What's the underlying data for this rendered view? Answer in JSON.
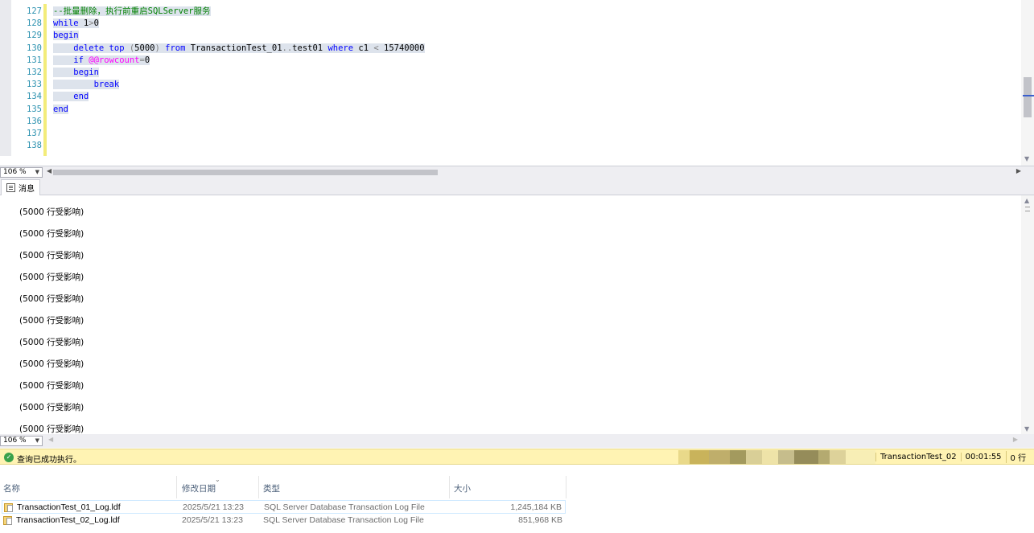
{
  "editor": {
    "line_numbers": [
      "127",
      "128",
      "129",
      "130",
      "131",
      "132",
      "133",
      "134",
      "135",
      "136",
      "137",
      "138"
    ],
    "lines": [
      [
        {
          "t": "--批量删除，执行前重启SQLServer服务",
          "c": "cm"
        }
      ],
      [
        {
          "t": "while",
          "c": "kw"
        },
        {
          "t": " 1",
          "c": "tx"
        },
        {
          "t": ">",
          "c": "gr"
        },
        {
          "t": "0",
          "c": "tx"
        }
      ],
      [
        {
          "t": "begin",
          "c": "kw"
        }
      ],
      [
        {
          "t": "    ",
          "c": "tx"
        },
        {
          "t": "delete top",
          "c": "kw"
        },
        {
          "t": " (",
          "c": "gr"
        },
        {
          "t": "5000",
          "c": "tx"
        },
        {
          "t": ")",
          "c": "gr"
        },
        {
          "t": " from",
          "c": "kw"
        },
        {
          "t": " TransactionTest_01",
          "c": "tx"
        },
        {
          "t": "..",
          "c": "gr"
        },
        {
          "t": "test01 ",
          "c": "tx"
        },
        {
          "t": "where",
          "c": "kw"
        },
        {
          "t": " c1 ",
          "c": "tx"
        },
        {
          "t": "<",
          "c": "gr"
        },
        {
          "t": " 15740000",
          "c": "tx"
        }
      ],
      [
        {
          "t": "    ",
          "c": "tx"
        },
        {
          "t": "if",
          "c": "kw"
        },
        {
          "t": " ",
          "c": "tx"
        },
        {
          "t": "@@rowcount",
          "c": "sv"
        },
        {
          "t": "=",
          "c": "gr"
        },
        {
          "t": "0",
          "c": "tx"
        }
      ],
      [
        {
          "t": "    ",
          "c": "tx"
        },
        {
          "t": "begin",
          "c": "kw"
        }
      ],
      [
        {
          "t": "        ",
          "c": "tx"
        },
        {
          "t": "break",
          "c": "kw"
        }
      ],
      [
        {
          "t": "    ",
          "c": "tx"
        },
        {
          "t": "end",
          "c": "kw"
        }
      ],
      [
        {
          "t": "end",
          "c": "kw"
        }
      ],
      [],
      [],
      []
    ],
    "zoom": "106 %"
  },
  "results": {
    "tab_label": "消息",
    "messages": [
      "(5000 行受影响)",
      "(5000 行受影响)",
      "(5000 行受影响)",
      "(5000 行受影响)",
      "(5000 行受影响)",
      "(5000 行受影响)",
      "(5000 行受影响)",
      "(5000 行受影响)",
      "(5000 行受影响)",
      "(5000 行受影响)",
      "(5000 行受影响)"
    ],
    "zoom": "106 %"
  },
  "status": {
    "text": "查询已成功执行。",
    "database": "TransactionTest_02",
    "elapsed": "00:01:55",
    "rows": "0 行",
    "colors": {
      "bar": "#fff3b3",
      "ok": "#3aa14a"
    }
  },
  "explorer": {
    "headers": {
      "name": "名称",
      "date": "修改日期",
      "type": "类型",
      "size": "大小"
    },
    "files": [
      {
        "name": "TransactionTest_01_Log.ldf",
        "date": "2025/5/21 13:23",
        "type": "SQL Server Database Transaction Log File",
        "size": "1,245,184 KB"
      },
      {
        "name": "TransactionTest_02_Log.ldf",
        "date": "2025/5/21 13:23",
        "type": "SQL Server Database Transaction Log File",
        "size": "851,968 KB"
      }
    ]
  }
}
